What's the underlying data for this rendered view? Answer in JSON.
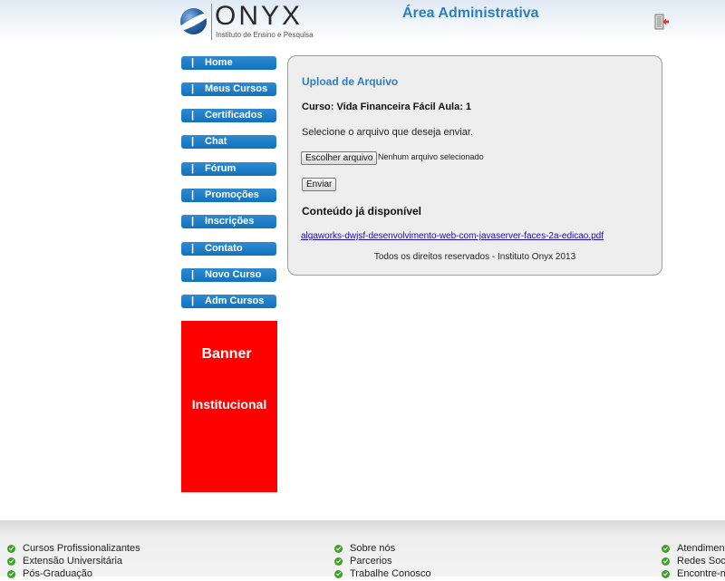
{
  "header": {
    "logo_word": "ONYX",
    "logo_subtitle": "Instituto de Ensino e Pesquisa",
    "admin_title": "Área Administrativa",
    "exit_icon": "exit-door-icon"
  },
  "menu": {
    "bar": "|",
    "items": [
      {
        "label": "Home"
      },
      {
        "label": "Meus Cursos"
      },
      {
        "label": "Certificados"
      },
      {
        "label": "Chat"
      },
      {
        "label": "Fórum"
      },
      {
        "label": "Promoções"
      },
      {
        "label": "Inscrições"
      },
      {
        "label": "Contato"
      },
      {
        "label": "Novo Curso"
      },
      {
        "label": "Adm Cursos"
      }
    ]
  },
  "banner": {
    "line1": "Banner",
    "line2": "Institucional",
    "color": "#ff0000"
  },
  "upload": {
    "title": "Upload de Arquivo",
    "course_line": "Curso: Vida Financeira Fácil Aula: 1",
    "select_text": "Selecione o arquivo que deseja enviar.",
    "choose_button": "Escolher arquivo",
    "no_file": "Nenhum arquivo selecionado",
    "send_button": "Enviar",
    "available_title": "Conteúdo já disponível",
    "file_link": "algaworks-dwjsf-desenvolvimento-web-com-javaserver-faces-2a-edicao.pdf",
    "rights": "Todos os direitos reservados - Instituto Onyx 2013"
  },
  "footer": {
    "col1": [
      {
        "label": "Cursos Profissionalizantes"
      },
      {
        "label": "Extensão Universitária"
      },
      {
        "label": "Pós-Graduação"
      }
    ],
    "col2": [
      {
        "label": "Sobre nós"
      },
      {
        "label": "Parcerios"
      },
      {
        "label": "Trabalhe Conosco"
      }
    ],
    "col3": [
      {
        "label": "Atendiment"
      },
      {
        "label": "Redes Soci"
      },
      {
        "label": "Encontre-n"
      }
    ]
  },
  "colors": {
    "accent": "#2e7fc1",
    "menu": "#1173bd",
    "check": "#3fa12a",
    "link": "#1a0dab"
  }
}
